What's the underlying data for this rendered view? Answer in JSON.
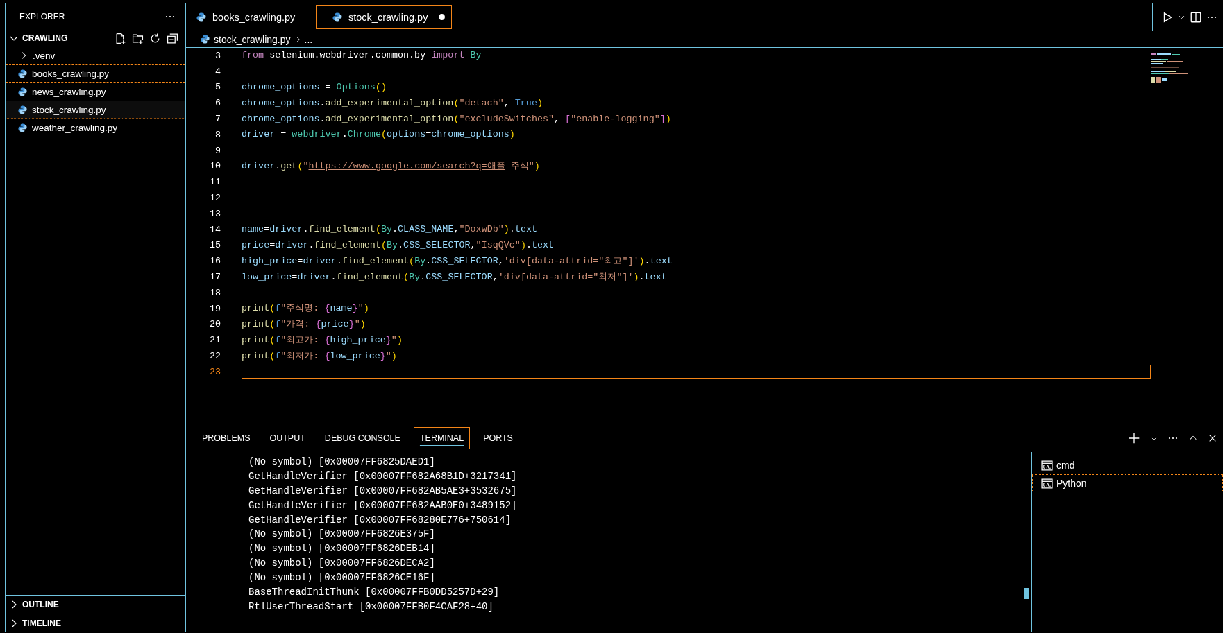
{
  "sidebar": {
    "title": "EXPLORER",
    "folder": {
      "label": "CRAWLING",
      "expanded": true,
      "items": [
        {
          "label": ".venv",
          "kind": "folder",
          "expanded": false,
          "selected": false,
          "focused": false
        },
        {
          "label": "books_crawling.py",
          "kind": "file",
          "selected": false,
          "focused": true
        },
        {
          "label": "news_crawling.py",
          "kind": "file",
          "selected": false,
          "focused": false
        },
        {
          "label": "stock_crawling.py",
          "kind": "file",
          "selected": true,
          "focused": false
        },
        {
          "label": "weather_crawling.py",
          "kind": "file",
          "selected": false,
          "focused": false
        }
      ]
    },
    "sections": [
      {
        "label": "OUTLINE",
        "expanded": false
      },
      {
        "label": "TIMELINE",
        "expanded": false
      }
    ]
  },
  "editor": {
    "tabs": [
      {
        "label": "books_crawling.py",
        "selected": false,
        "modified": false
      },
      {
        "label": "stock_crawling.py",
        "selected": true,
        "modified": true
      }
    ],
    "breadcrumb": [
      "stock_crawling.py",
      "..."
    ],
    "lines": [
      {
        "number": "3",
        "current": false,
        "tokens": [
          {
            "text": "from",
            "kind": "control"
          },
          {
            "text": " selenium.webdriver.common.by ",
            "kind": "plain"
          },
          {
            "text": "import",
            "kind": "control"
          },
          {
            "text": " By",
            "kind": "class"
          }
        ]
      },
      {
        "number": "4",
        "current": false
      },
      {
        "number": "5",
        "current": false,
        "tokens": [
          {
            "text": "chrome_options",
            "kind": "variable"
          },
          {
            "text": " = ",
            "kind": "plain"
          },
          {
            "text": "Options",
            "kind": "class"
          },
          {
            "text": "()",
            "kind": "bracket"
          }
        ]
      },
      {
        "number": "6",
        "current": false,
        "tokens": [
          {
            "text": "chrome_options",
            "kind": "variable"
          },
          {
            "text": ".",
            "kind": "plain"
          },
          {
            "text": "add_experimental_option",
            "kind": "function"
          },
          {
            "text": "(",
            "kind": "bracket"
          },
          {
            "text": "\"detach\"",
            "kind": "string"
          },
          {
            "text": ", ",
            "kind": "plain"
          },
          {
            "text": "True",
            "kind": "keyword"
          },
          {
            "text": ")",
            "kind": "bracket"
          }
        ]
      },
      {
        "number": "7",
        "current": false,
        "tokens": [
          {
            "text": "chrome_options",
            "kind": "variable"
          },
          {
            "text": ".",
            "kind": "plain"
          },
          {
            "text": "add_experimental_option",
            "kind": "function"
          },
          {
            "text": "(",
            "kind": "bracket"
          },
          {
            "text": "\"excludeSwitches\"",
            "kind": "string"
          },
          {
            "text": ", ",
            "kind": "plain"
          },
          {
            "text": "[",
            "kind": "bracket2"
          },
          {
            "text": "\"enable-logging\"",
            "kind": "string"
          },
          {
            "text": "]",
            "kind": "bracket2"
          },
          {
            "text": ")",
            "kind": "bracket"
          }
        ]
      },
      {
        "number": "8",
        "current": false,
        "tokens": [
          {
            "text": "driver",
            "kind": "variable"
          },
          {
            "text": " = ",
            "kind": "plain"
          },
          {
            "text": "webdriver",
            "kind": "class"
          },
          {
            "text": ".",
            "kind": "plain"
          },
          {
            "text": "Chrome",
            "kind": "class"
          },
          {
            "text": "(",
            "kind": "bracket"
          },
          {
            "text": "options",
            "kind": "variable"
          },
          {
            "text": "=",
            "kind": "plain"
          },
          {
            "text": "chrome_options",
            "kind": "variable"
          },
          {
            "text": ")",
            "kind": "bracket"
          }
        ]
      },
      {
        "number": "9",
        "current": false
      },
      {
        "number": "10",
        "current": false,
        "tokens": [
          {
            "text": "driver",
            "kind": "variable"
          },
          {
            "text": ".",
            "kind": "plain"
          },
          {
            "text": "get",
            "kind": "function"
          },
          {
            "text": "(",
            "kind": "bracket"
          },
          {
            "text": "\"",
            "kind": "string"
          },
          {
            "text": "https://www.google.com/search?q=애플",
            "kind": "link"
          },
          {
            "text": " 주식\"",
            "kind": "string"
          },
          {
            "text": ")",
            "kind": "bracket"
          }
        ]
      },
      {
        "number": "11",
        "current": false
      },
      {
        "number": "12",
        "current": false
      },
      {
        "number": "13",
        "current": false
      },
      {
        "number": "14",
        "current": false,
        "tokens": [
          {
            "text": "name",
            "kind": "variable"
          },
          {
            "text": "=",
            "kind": "plain"
          },
          {
            "text": "driver",
            "kind": "variable"
          },
          {
            "text": ".",
            "kind": "plain"
          },
          {
            "text": "find_element",
            "kind": "function"
          },
          {
            "text": "(",
            "kind": "bracket"
          },
          {
            "text": "By",
            "kind": "class"
          },
          {
            "text": ".",
            "kind": "plain"
          },
          {
            "text": "CLASS_NAME",
            "kind": "variable"
          },
          {
            "text": ",",
            "kind": "plain"
          },
          {
            "text": "\"DoxwDb\"",
            "kind": "string"
          },
          {
            "text": ")",
            "kind": "bracket"
          },
          {
            "text": ".",
            "kind": "plain"
          },
          {
            "text": "text",
            "kind": "variable"
          }
        ]
      },
      {
        "number": "15",
        "current": false,
        "tokens": [
          {
            "text": "price",
            "kind": "variable"
          },
          {
            "text": "=",
            "kind": "plain"
          },
          {
            "text": "driver",
            "kind": "variable"
          },
          {
            "text": ".",
            "kind": "plain"
          },
          {
            "text": "find_element",
            "kind": "function"
          },
          {
            "text": "(",
            "kind": "bracket"
          },
          {
            "text": "By",
            "kind": "class"
          },
          {
            "text": ".",
            "kind": "plain"
          },
          {
            "text": "CSS_SELECTOR",
            "kind": "variable"
          },
          {
            "text": ",",
            "kind": "plain"
          },
          {
            "text": "\"IsqQVc\"",
            "kind": "string"
          },
          {
            "text": ")",
            "kind": "bracket"
          },
          {
            "text": ".",
            "kind": "plain"
          },
          {
            "text": "text",
            "kind": "variable"
          }
        ]
      },
      {
        "number": "16",
        "current": false,
        "tokens": [
          {
            "text": "high_price",
            "kind": "variable"
          },
          {
            "text": "=",
            "kind": "plain"
          },
          {
            "text": "driver",
            "kind": "variable"
          },
          {
            "text": ".",
            "kind": "plain"
          },
          {
            "text": "find_element",
            "kind": "function"
          },
          {
            "text": "(",
            "kind": "bracket"
          },
          {
            "text": "By",
            "kind": "class"
          },
          {
            "text": ".",
            "kind": "plain"
          },
          {
            "text": "CSS_SELECTOR",
            "kind": "variable"
          },
          {
            "text": ",",
            "kind": "plain"
          },
          {
            "text": "'div[data-attrid=\"최고\"]'",
            "kind": "string"
          },
          {
            "text": ")",
            "kind": "bracket"
          },
          {
            "text": ".",
            "kind": "plain"
          },
          {
            "text": "text",
            "kind": "variable"
          }
        ]
      },
      {
        "number": "17",
        "current": false,
        "tokens": [
          {
            "text": "low_price",
            "kind": "variable"
          },
          {
            "text": "=",
            "kind": "plain"
          },
          {
            "text": "driver",
            "kind": "variable"
          },
          {
            "text": ".",
            "kind": "plain"
          },
          {
            "text": "find_element",
            "kind": "function"
          },
          {
            "text": "(",
            "kind": "bracket"
          },
          {
            "text": "By",
            "kind": "class"
          },
          {
            "text": ".",
            "kind": "plain"
          },
          {
            "text": "CSS_SELECTOR",
            "kind": "variable"
          },
          {
            "text": ",",
            "kind": "plain"
          },
          {
            "text": "'div[data-attrid=\"최저\"]'",
            "kind": "string"
          },
          {
            "text": ")",
            "kind": "bracket"
          },
          {
            "text": ".",
            "kind": "plain"
          },
          {
            "text": "text",
            "kind": "variable"
          }
        ]
      },
      {
        "number": "18",
        "current": false
      },
      {
        "number": "19",
        "current": false,
        "tokens": [
          {
            "text": "print",
            "kind": "function"
          },
          {
            "text": "(",
            "kind": "bracket"
          },
          {
            "text": "f",
            "kind": "keyword"
          },
          {
            "text": "\"주식명: ",
            "kind": "string"
          },
          {
            "text": "{",
            "kind": "bracket2"
          },
          {
            "text": "name",
            "kind": "variable"
          },
          {
            "text": "}",
            "kind": "bracket2"
          },
          {
            "text": "\"",
            "kind": "string"
          },
          {
            "text": ")",
            "kind": "bracket"
          }
        ]
      },
      {
        "number": "20",
        "current": false,
        "tokens": [
          {
            "text": "print",
            "kind": "function"
          },
          {
            "text": "(",
            "kind": "bracket"
          },
          {
            "text": "f",
            "kind": "keyword"
          },
          {
            "text": "\"가격: ",
            "kind": "string"
          },
          {
            "text": "{",
            "kind": "bracket2"
          },
          {
            "text": "price",
            "kind": "variable"
          },
          {
            "text": "}",
            "kind": "bracket2"
          },
          {
            "text": "\"",
            "kind": "string"
          },
          {
            "text": ")",
            "kind": "bracket"
          }
        ]
      },
      {
        "number": "21",
        "current": false,
        "tokens": [
          {
            "text": "print",
            "kind": "function"
          },
          {
            "text": "(",
            "kind": "bracket"
          },
          {
            "text": "f",
            "kind": "keyword"
          },
          {
            "text": "\"최고가: ",
            "kind": "string"
          },
          {
            "text": "{",
            "kind": "bracket2"
          },
          {
            "text": "high_price",
            "kind": "variable"
          },
          {
            "text": "}",
            "kind": "bracket2"
          },
          {
            "text": "\"",
            "kind": "string"
          },
          {
            "text": ")",
            "kind": "bracket"
          }
        ]
      },
      {
        "number": "22",
        "current": false,
        "tokens": [
          {
            "text": "print",
            "kind": "function"
          },
          {
            "text": "(",
            "kind": "bracket"
          },
          {
            "text": "f",
            "kind": "keyword"
          },
          {
            "text": "\"최저가: ",
            "kind": "string"
          },
          {
            "text": "{",
            "kind": "bracket2"
          },
          {
            "text": "low_price",
            "kind": "variable"
          },
          {
            "text": "}",
            "kind": "bracket2"
          },
          {
            "text": "\"",
            "kind": "string"
          },
          {
            "text": ")",
            "kind": "bracket"
          }
        ]
      },
      {
        "number": "23",
        "current": true
      }
    ]
  },
  "panel": {
    "tabs": [
      {
        "label": "PROBLEMS",
        "selected": false
      },
      {
        "label": "OUTPUT",
        "selected": false
      },
      {
        "label": "DEBUG CONSOLE",
        "selected": false
      },
      {
        "label": "TERMINAL",
        "selected": true
      },
      {
        "label": "PORTS",
        "selected": false
      }
    ],
    "terminal_lines": [
      "(No symbol) [0x00007FF6825DAED1]",
      "GetHandleVerifier [0x00007FF682A68B1D+3217341]",
      "GetHandleVerifier [0x00007FF682AB5AE3+3532675]",
      "GetHandleVerifier [0x00007FF682AAB0E0+3489152]",
      "GetHandleVerifier [0x00007FF68280E776+750614]",
      "(No symbol) [0x00007FF6826E375F]",
      "(No symbol) [0x00007FF6826DEB14]",
      "(No symbol) [0x00007FF6826DECA2]",
      "(No symbol) [0x00007FF6826CE16F]",
      "BaseThreadInitThunk [0x00007FFB0DD5257D+29]",
      "RtlUserThreadStart [0x00007FFB0F4CAF28+40]"
    ],
    "sessions": [
      {
        "label": "cmd",
        "selected": false
      },
      {
        "label": "Python",
        "selected": true
      }
    ]
  }
}
